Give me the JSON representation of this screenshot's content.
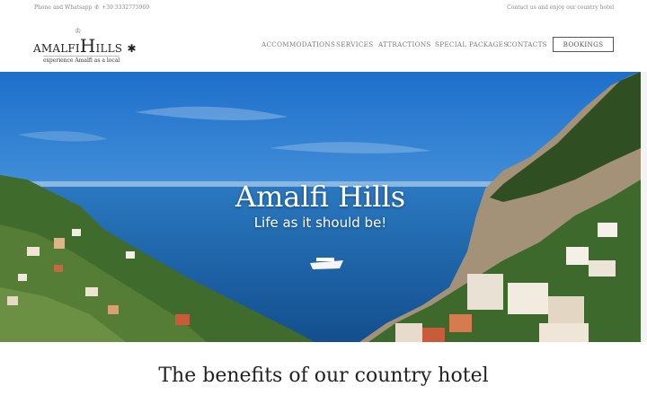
{
  "topbar": {
    "phone_prefix": "Phone and Whatsapp",
    "phone_icon": "phone-icon",
    "phone_number": "+39 3332775969",
    "right_text": "Contact us and enjoy our country hotel"
  },
  "logo": {
    "name_first": "AMALFI",
    "name_h": "H",
    "name_rest": "ILLS",
    "star": "✱",
    "crown": "♔",
    "tagline": "experience Amalfi as a local"
  },
  "nav": {
    "items": [
      "ACCOMMODATIONS",
      "SERVICES",
      "ATTRACTIONS",
      "SPECIAL PACKAGES",
      "CONTACTS"
    ],
    "booking_label": "BOOKINGS"
  },
  "hero": {
    "title": "Amalfi Hills",
    "subtitle": "Life as it should be!"
  },
  "section": {
    "title": "The benefits of our country hotel"
  },
  "colors": {
    "sky": "#2f7fd0",
    "sea": "#1f6bb3",
    "cliff_green": "#3d6b2c",
    "accent_text": "#7a7a7a"
  }
}
